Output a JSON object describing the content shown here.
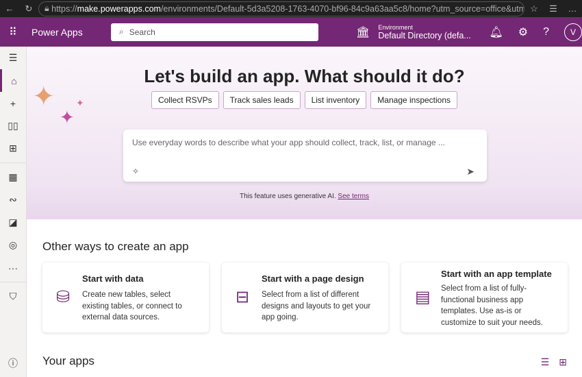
{
  "browser": {
    "url_domain": "make.powerapps.com",
    "url_prefix": "https://",
    "url_rest": "/environments/Default-5d3a5208-1763-4070-bf96-84c9a63aa5c8/home?utm_source=office&utm_med..."
  },
  "topbar": {
    "app_name": "Power Apps",
    "search_placeholder": "Search",
    "env_label": "Environment",
    "env_value": "Default Directory (defa...",
    "avatar": "V"
  },
  "hero": {
    "title": "Let's build an app. What should it do?",
    "chips": [
      "Collect RSVPs",
      "Track sales leads",
      "List inventory",
      "Manage inspections"
    ],
    "prompt_placeholder": "Use everyday words to describe what your app should collect, track, list, or manage ...",
    "note": "This feature uses generative AI.",
    "note_link": "See terms"
  },
  "other": {
    "heading": "Other ways to create an app",
    "cards": [
      {
        "title": "Start with data",
        "desc": "Create new tables, select existing tables, or connect to external data sources."
      },
      {
        "title": "Start with a page design",
        "desc": "Select from a list of different designs and layouts to get your app going."
      },
      {
        "title": "Start with an app template",
        "desc": "Select from a list of fully-functional business app templates. Use as-is or customize to suit your needs."
      }
    ]
  },
  "your_apps": {
    "heading": "Your apps"
  }
}
